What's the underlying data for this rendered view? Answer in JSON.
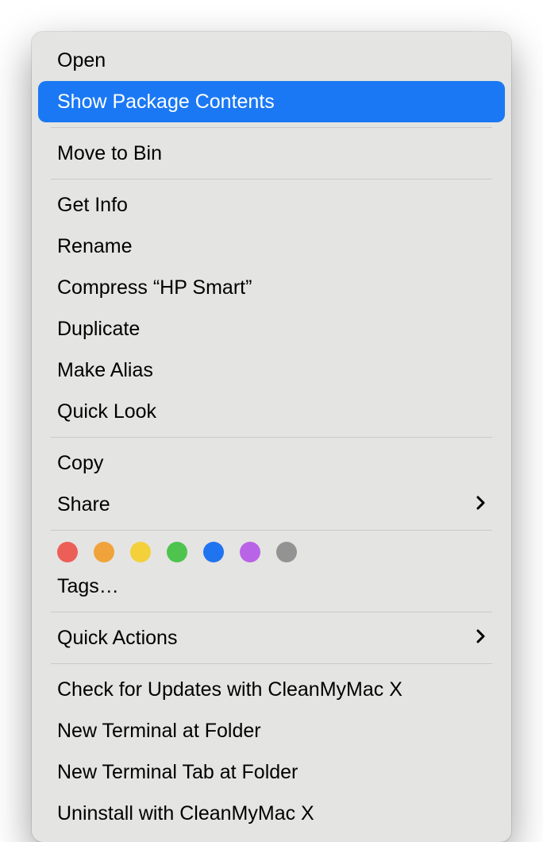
{
  "menu": {
    "open": "Open",
    "show_package_contents": "Show Package Contents",
    "move_to_bin": "Move to Bin",
    "get_info": "Get Info",
    "rename": "Rename",
    "compress": "Compress “HP Smart”",
    "duplicate": "Duplicate",
    "make_alias": "Make Alias",
    "quick_look": "Quick Look",
    "copy": "Copy",
    "share": "Share",
    "tags": "Tags…",
    "quick_actions": "Quick Actions",
    "check_updates": "Check for Updates with CleanMyMac X",
    "new_terminal": "New Terminal at Folder",
    "new_terminal_tab": "New Terminal Tab at Folder",
    "uninstall": "Uninstall with CleanMyMac X"
  },
  "tag_colors": {
    "red": "#ec5f58",
    "orange": "#f0a33b",
    "yellow": "#f4d03b",
    "green": "#4ec44e",
    "blue": "#2174f0",
    "purple": "#b963e6",
    "gray": "#939393"
  }
}
